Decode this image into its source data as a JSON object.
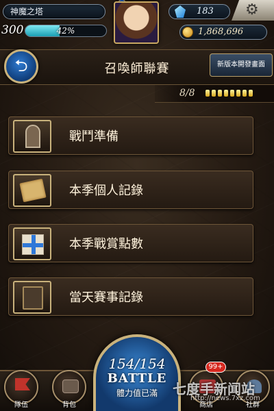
{
  "hud": {
    "tower_name": "神魔之塔",
    "level": "300",
    "exp_percent": "42%",
    "exp_fraction": 0.42,
    "gems": "183",
    "gold": "1,868,696"
  },
  "header": {
    "back_icon": "back-arrow-icon",
    "title": "召喚師聯賽",
    "new_version_label": "新版本開發畫面"
  },
  "progress": {
    "text": "8/8",
    "filled": 8,
    "total": 8
  },
  "menu": {
    "items": [
      {
        "label": "戰鬥準備",
        "icon": "door-icon"
      },
      {
        "label": "本季個人記錄",
        "icon": "scroll-icon"
      },
      {
        "label": "本季戰賞點數",
        "icon": "gift-icon"
      },
      {
        "label": "當天賽事記錄",
        "icon": "book-icon"
      }
    ]
  },
  "bottom": {
    "team_label": "隊伍",
    "bag_label": "背包",
    "shop_label": "商店",
    "social_label": "社群",
    "badge": "99+",
    "stamina": "154/154",
    "battle_label": "BATTLE",
    "stamina_status": "體力值已滿"
  },
  "watermark": {
    "text": "七度手新闻站",
    "url": "http://news.7xz.com"
  },
  "colors": {
    "accent_blue": "#2f7bd1",
    "gold_trim": "#c9b27c",
    "badge_red": "#d6281f"
  }
}
